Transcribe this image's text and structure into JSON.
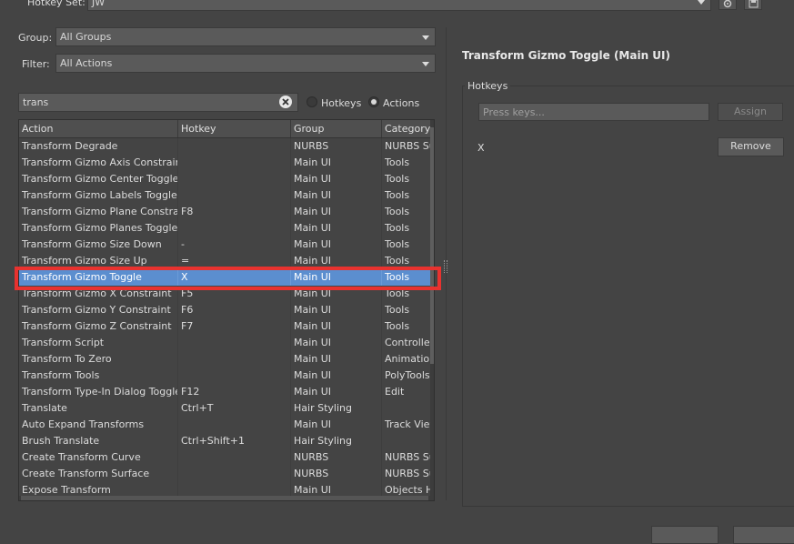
{
  "hotkey_set": {
    "label": "Hotkey Set:",
    "value": "JW"
  },
  "filters": {
    "group_label": "Group:",
    "group_value": "All Groups",
    "filter_label": "Filter:",
    "filter_value": "All Actions"
  },
  "search": {
    "value": "trans",
    "radio_hotkeys": "Hotkeys",
    "radio_actions": "Actions",
    "selected": "Actions"
  },
  "table": {
    "columns": [
      "Action",
      "Hotkey",
      "Group",
      "Category"
    ],
    "rows": [
      [
        "Transform Degrade",
        "",
        "NURBS",
        "NURBS Su"
      ],
      [
        "Transform Gizmo Axis Constraint ...",
        "",
        "Main UI",
        "Tools"
      ],
      [
        "Transform Gizmo Center Toggle",
        "",
        "Main UI",
        "Tools"
      ],
      [
        "Transform Gizmo Labels Toggle",
        "",
        "Main UI",
        "Tools"
      ],
      [
        "Transform Gizmo Plane Constrain...",
        "F8",
        "Main UI",
        "Tools"
      ],
      [
        "Transform Gizmo Planes Toggle",
        "",
        "Main UI",
        "Tools"
      ],
      [
        "Transform Gizmo Size Down",
        "-",
        "Main UI",
        "Tools"
      ],
      [
        "Transform Gizmo Size Up",
        "=",
        "Main UI",
        "Tools"
      ],
      [
        "Transform Gizmo Toggle",
        "X",
        "Main UI",
        "Tools"
      ],
      [
        "Transform Gizmo X Constraint",
        "F5",
        "Main UI",
        "Tools"
      ],
      [
        "Transform Gizmo Y Constraint",
        "F6",
        "Main UI",
        "Tools"
      ],
      [
        "Transform Gizmo Z Constraint",
        "F7",
        "Main UI",
        "Tools"
      ],
      [
        "Transform Script",
        "",
        "Main UI",
        "Controller"
      ],
      [
        "Transform To Zero",
        "",
        "Main UI",
        "Animation"
      ],
      [
        "Transform Tools",
        "",
        "Main UI",
        "PolyTools"
      ],
      [
        "Transform Type-In Dialog Toggle",
        "F12",
        "Main UI",
        "Edit"
      ],
      [
        "Translate",
        "Ctrl+T",
        "Hair Styling",
        ""
      ],
      [
        "Auto Expand Transforms",
        "",
        "Main UI",
        "Track View"
      ],
      [
        "Brush Translate",
        "Ctrl+Shift+1",
        "Hair Styling",
        ""
      ],
      [
        "Create Transform Curve",
        "",
        "NURBS",
        "NURBS Su"
      ],
      [
        "Create Transform Surface",
        "",
        "NURBS",
        "NURBS Su"
      ],
      [
        "Expose Transform",
        "",
        "Main UI",
        "Objects H"
      ]
    ],
    "selected_index": 8
  },
  "detail": {
    "title": "Transform Gizmo Toggle (Main UI)",
    "hotkeys_group_label": "Hotkeys",
    "press_keys_placeholder": "Press keys...",
    "assign_label": "Assign",
    "assigned_key": "X",
    "remove_label": "Remove"
  },
  "colors": {
    "selection": "#5b8ecf",
    "highlight": "#e8322f"
  }
}
